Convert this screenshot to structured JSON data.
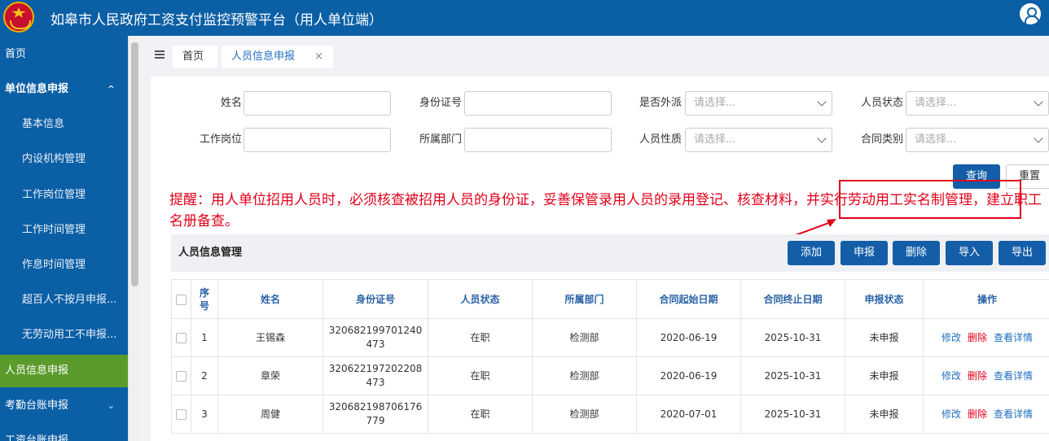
{
  "header": {
    "title": "如皋市人民政府工资支付监控预警平台（用人单位端）"
  },
  "icons": {
    "emblem": "national-emblem-icon",
    "user": "user-icon",
    "menu": "menu-toggle-icon",
    "close": "close-icon",
    "chevron": "chevron-down-icon"
  },
  "sidebar": {
    "items": [
      {
        "label": "首页"
      },
      {
        "label": "单位信息申报",
        "chevron": "^"
      },
      {
        "label": "基本信息"
      },
      {
        "label": "内设机构管理"
      },
      {
        "label": "工作岗位管理"
      },
      {
        "label": "工作时间管理"
      },
      {
        "label": "作息时间管理"
      },
      {
        "label": "超百人不按月申报..."
      },
      {
        "label": "无劳动用工不申报..."
      },
      {
        "label": "人员信息申报"
      },
      {
        "label": "考勤台账申报",
        "chevron": "⌄"
      },
      {
        "label": "工资台账申报",
        "chevron": "⌄"
      }
    ]
  },
  "tabs": {
    "home": "首页",
    "active": "人员信息申报",
    "close": "×"
  },
  "filters": {
    "name_label": "姓名",
    "id_label": "身份证号",
    "dispatch_label": "是否外派",
    "dispatch_placeholder": "请选择...",
    "status_label": "人员状态",
    "status_placeholder": "请选择...",
    "post_label": "工作岗位",
    "dept_label": "所属部门",
    "nature_label": "人员性质",
    "nature_placeholder": "请选择...",
    "contract_label": "合同类别",
    "contract_placeholder": "请选择..."
  },
  "buttons": {
    "query": "查询",
    "reset": "重置",
    "add": "添加",
    "submit": "申报",
    "delete": "删除",
    "import": "导入",
    "export": "导出"
  },
  "notice": {
    "text": "提醒：用人单位招用人员时，必须核查被招用人员的身份证，妥善保管录用人员的录用登记、核查材料，并实行劳动用工实名制管理，建立职工名册备查。"
  },
  "section": {
    "title": "人员信息管理"
  },
  "table": {
    "headers": [
      "序号",
      "姓名",
      "身份证号",
      "人员状态",
      "所属部门",
      "合同起始日期",
      "合同终止日期",
      "申报状态",
      "操作"
    ],
    "rows": [
      {
        "no": "1",
        "name": "王锡森",
        "id": "320682199701240473",
        "status": "在职",
        "dept": "检测部",
        "start": "2020-06-19",
        "end": "2025-10-31",
        "report": "未申报"
      },
      {
        "no": "2",
        "name": "章荣",
        "id": "320622197202208473",
        "status": "在职",
        "dept": "检测部",
        "start": "2020-06-19",
        "end": "2025-10-31",
        "report": "未申报"
      },
      {
        "no": "3",
        "name": "周健",
        "id": "320682198706176779",
        "status": "在职",
        "dept": "检测部",
        "start": "2020-07-01",
        "end": "2025-10-31",
        "report": "未申报"
      }
    ],
    "ops": {
      "edit": "修改",
      "del": "删除",
      "view": "查看详情"
    }
  },
  "colors": {
    "primary": "#0b5fa5",
    "active_menu": "#5b9b2b",
    "button": "#145ea8",
    "alert": "#e0001a"
  }
}
